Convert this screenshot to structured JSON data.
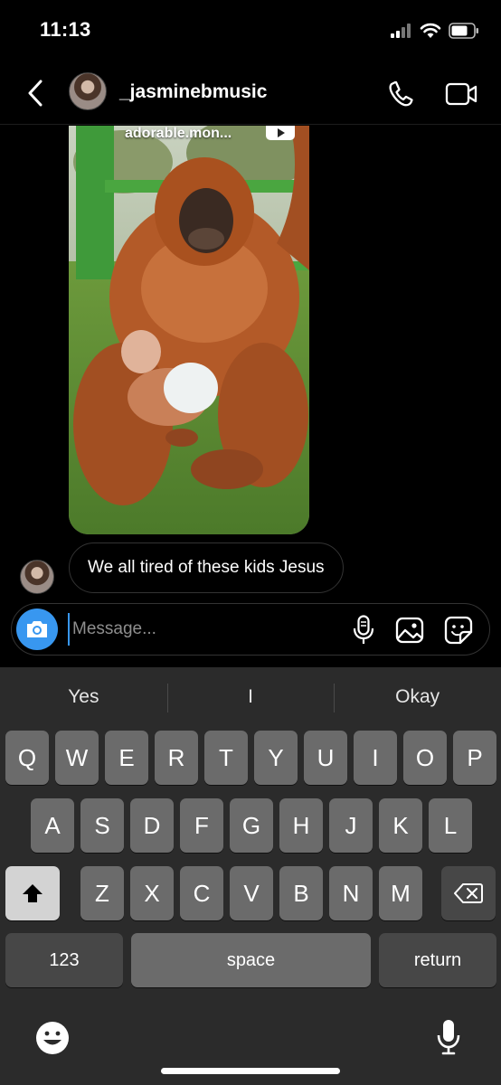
{
  "status_bar": {
    "time": "11:13",
    "icons": [
      "cellular-signal-icon",
      "wifi-icon",
      "battery-icon"
    ]
  },
  "header": {
    "username": "_jasminebmusic",
    "icons": {
      "back": "chevron-left-icon",
      "call": "phone-icon",
      "video": "video-camera-icon"
    }
  },
  "shared_post": {
    "caption": "adorable.mon..."
  },
  "messages": [
    {
      "text": "We all tired of these kids Jesus"
    }
  ],
  "composer": {
    "placeholder": "Message...",
    "icons": [
      "camera-icon",
      "microphone-icon",
      "gallery-icon",
      "sticker-icon"
    ]
  },
  "keyboard": {
    "suggestions": [
      "Yes",
      "I",
      "Okay"
    ],
    "row1": [
      "Q",
      "W",
      "E",
      "R",
      "T",
      "Y",
      "U",
      "I",
      "O",
      "P"
    ],
    "row2": [
      "A",
      "S",
      "D",
      "F",
      "G",
      "H",
      "J",
      "K",
      "L"
    ],
    "row3": [
      "Z",
      "X",
      "C",
      "V",
      "B",
      "N",
      "M"
    ],
    "numbers_key": "123",
    "space_key": "space",
    "return_key": "return",
    "icons": [
      "shift-icon",
      "backspace-icon",
      "emoji-icon",
      "dictation-mic-icon"
    ]
  },
  "colors": {
    "accent": "#3897f0",
    "background": "#000000",
    "keyboard": "#2b2b2b"
  }
}
